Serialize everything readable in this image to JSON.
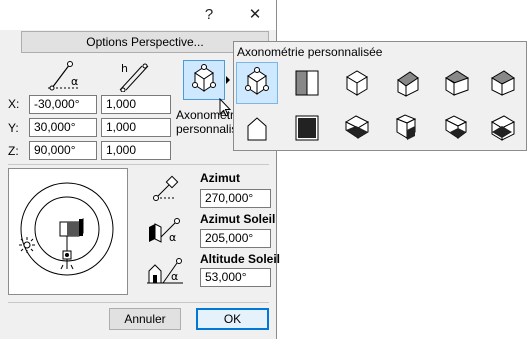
{
  "titlebar": {
    "help": "?",
    "close": "✕"
  },
  "options_button": "Options Perspective...",
  "axes": {
    "x": "X:",
    "y": "Y:",
    "z": "Z:"
  },
  "angle_col": {
    "x": "-30,000°",
    "y": "30,000°",
    "z": "90,000°"
  },
  "scale_col": {
    "x": "1,000",
    "y": "1,000",
    "z": "1,000"
  },
  "projection_label": {
    "line1": "Axonométrie",
    "line2": "personnalisée"
  },
  "sun": {
    "azimut_label": "Azimut",
    "azimut_value": "270,000°",
    "sun_azimut_label": "Azimut Soleil",
    "sun_azimut_value": "205,000°",
    "sun_altitude_label": "Altitude Soleil",
    "sun_altitude_value": "53,000°"
  },
  "buttons": {
    "cancel": "Annuler",
    "ok": "OK"
  },
  "popup": {
    "title": "Axonométrie personnalisée",
    "tiles_row1": [
      "custom-axonometry",
      "elevation",
      "isometric",
      "dimetric",
      "trimetric-left",
      "trimetric-right"
    ],
    "tiles_row2": [
      "house-front",
      "plan-view",
      "cabinet-bottom-left",
      "cabinet-bottom-front",
      "military-bottom",
      "cabinet-bottom-right"
    ]
  },
  "colors": {
    "selected_bg": "#cde8ff",
    "ok_border": "#0078d7",
    "dialog_bg": "#f0f0f0"
  }
}
